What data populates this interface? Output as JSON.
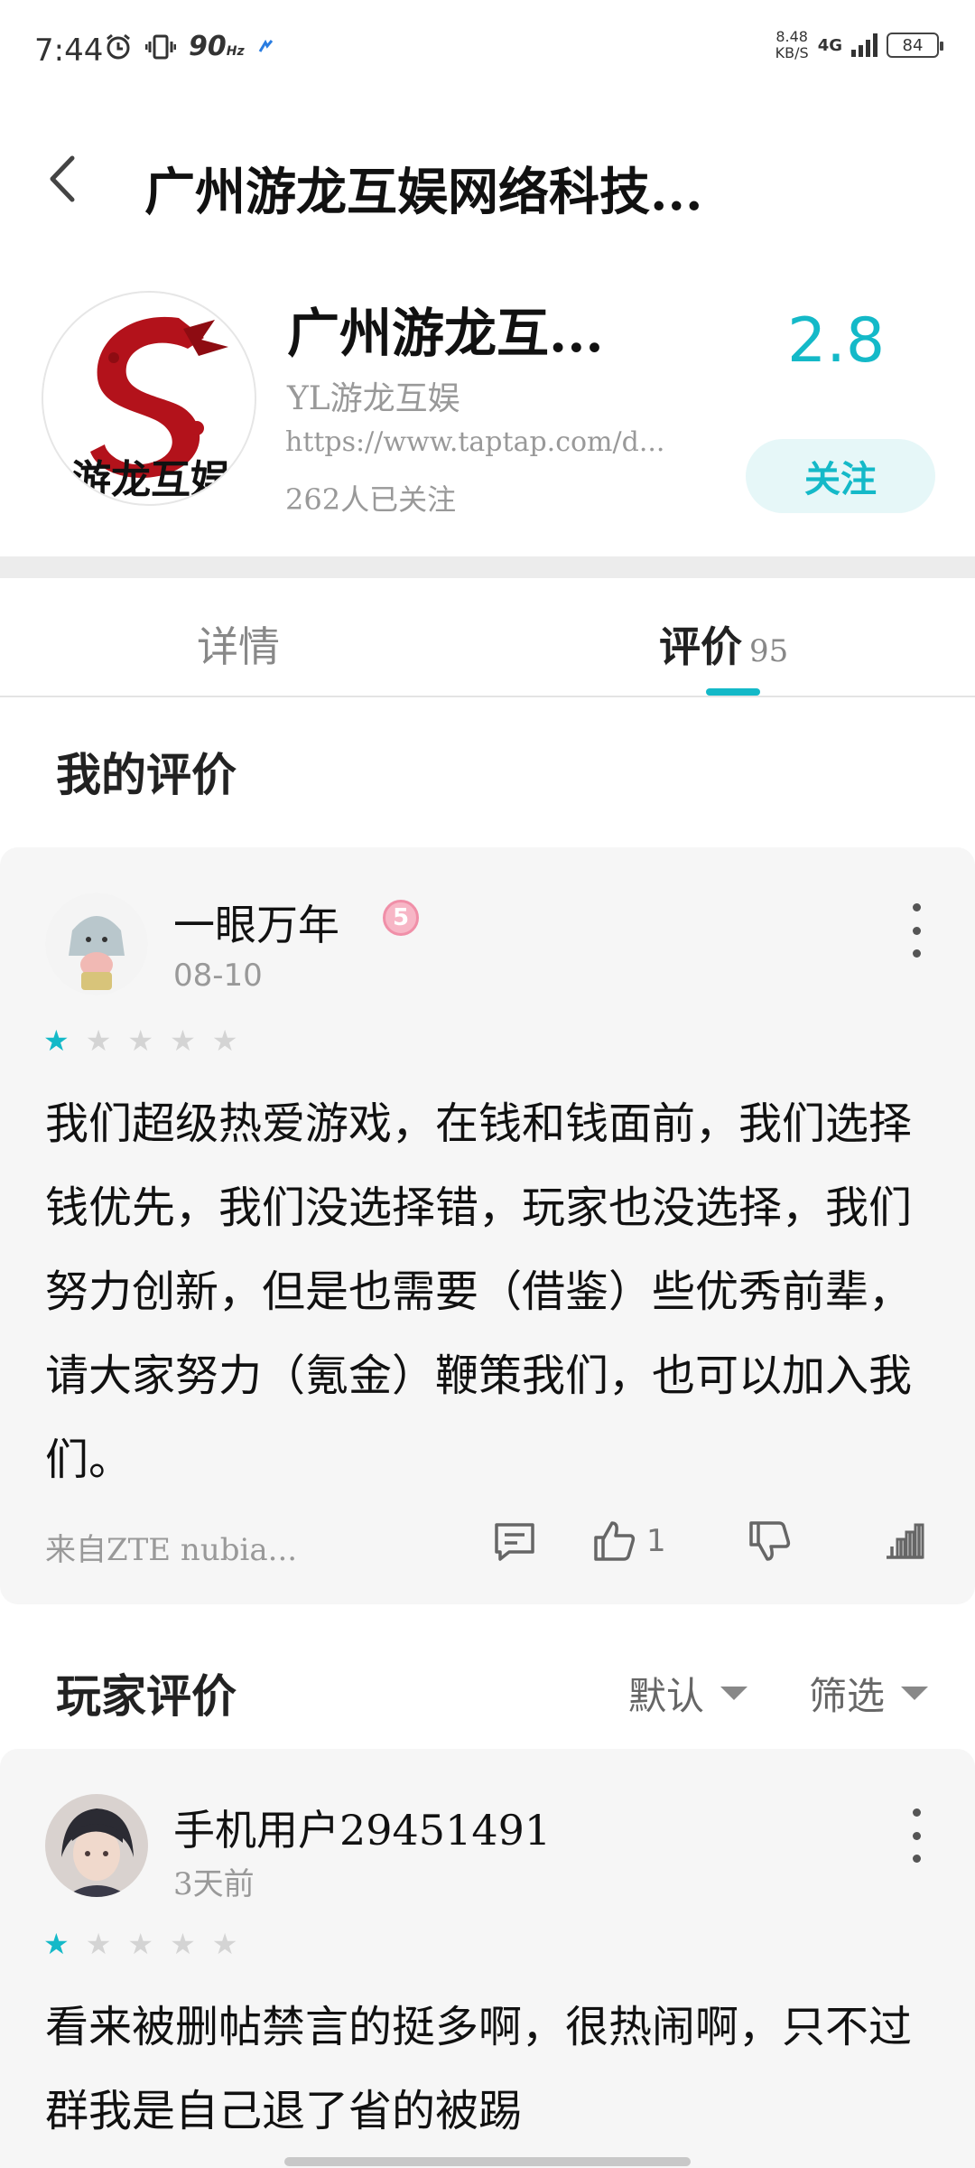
{
  "status_bar": {
    "time": "7:44",
    "refresh": "90",
    "refresh_unit": "Hz",
    "net_speed": "8.48",
    "net_unit": "KB/S",
    "network": "4G",
    "battery": "84"
  },
  "header": {
    "title": "广州游龙互娱网络科技..."
  },
  "company": {
    "name": "广州游龙互...",
    "alias": "YL游龙互娱",
    "url": "https://www.taptap.com/d...",
    "followers": "262人已关注",
    "rating": "2.8",
    "follow_label": "关注",
    "logo_text": "游龙互娱"
  },
  "tabs": [
    {
      "label": "详情"
    },
    {
      "label": "评价",
      "count": "95"
    }
  ],
  "my_review_section": {
    "title": "我的评价",
    "review": {
      "user": "一眼万年",
      "level": "5",
      "date": "08-10",
      "rating": 1,
      "max_rating": 5,
      "text": "我们超级热爱游戏，在钱和钱面前，我们选择钱优先，我们没选择错，玩家也没选择，我们努力创新，但是也需要（借鉴）些优秀前辈，请大家努力（氪金）鞭策我们，也可以加入我们。",
      "device": "来自ZTE nubia...",
      "likes": "1"
    }
  },
  "player_reviews": {
    "title": "玩家评价",
    "sort_label": "默认",
    "filter_label": "筛选",
    "reviews": [
      {
        "user": "手机用户29451491",
        "date": "3天前",
        "rating": 1,
        "max_rating": 5,
        "text": "看来被删帖禁言的挺多啊，很热闹啊，只不过群我是自己退了省的被踢"
      }
    ]
  },
  "colors": {
    "accent": "#14b9c8",
    "card_bg": "#f6f6f6",
    "logo_red": "#b3121b"
  }
}
